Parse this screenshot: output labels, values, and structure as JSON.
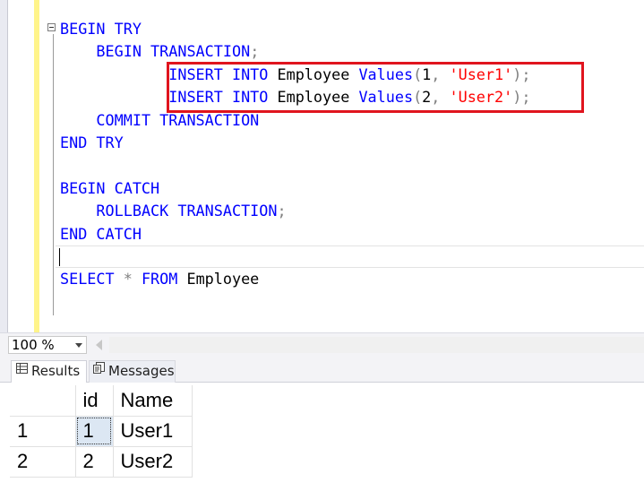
{
  "editor": {
    "lines": [
      [
        {
          "t": "BEGIN TRY",
          "c": "kw"
        }
      ],
      [
        {
          "t": "    "
        },
        {
          "t": "BEGIN TRANSACTION",
          "c": "kw"
        },
        {
          "t": ";",
          "c": "gr"
        }
      ],
      [
        {
          "t": "            "
        },
        {
          "t": "INSERT INTO",
          "c": "kw"
        },
        {
          "t": " Employee "
        },
        {
          "t": "Values",
          "c": "kw"
        },
        {
          "t": "(",
          "c": "gr"
        },
        {
          "t": "1"
        },
        {
          "t": ", ",
          "c": "gr"
        },
        {
          "t": "'User1'",
          "c": "str"
        },
        {
          "t": ");",
          "c": "gr"
        }
      ],
      [
        {
          "t": "            "
        },
        {
          "t": "INSERT INTO",
          "c": "kw"
        },
        {
          "t": " Employee "
        },
        {
          "t": "Values",
          "c": "kw"
        },
        {
          "t": "(",
          "c": "gr"
        },
        {
          "t": "2"
        },
        {
          "t": ", ",
          "c": "gr"
        },
        {
          "t": "'User2'",
          "c": "str"
        },
        {
          "t": ");",
          "c": "gr"
        }
      ],
      [
        {
          "t": "    "
        },
        {
          "t": "COMMIT TRANSACTION",
          "c": "kw"
        }
      ],
      [
        {
          "t": "END TRY",
          "c": "kw"
        }
      ],
      [
        {
          "t": ""
        }
      ],
      [
        {
          "t": "BEGIN CATCH",
          "c": "kw"
        }
      ],
      [
        {
          "t": "    "
        },
        {
          "t": "ROLLBACK TRANSACTION",
          "c": "kw"
        },
        {
          "t": ";",
          "c": "gr"
        }
      ],
      [
        {
          "t": "END CATCH",
          "c": "kw"
        }
      ],
      [
        {
          "t": ""
        }
      ],
      [
        {
          "t": "SELECT",
          "c": "kw"
        },
        {
          "t": " * ",
          "c": "gr"
        },
        {
          "t": "FROM",
          "c": "kw"
        },
        {
          "t": " Employee"
        }
      ]
    ]
  },
  "zoom": {
    "value": "100 %"
  },
  "tabs": {
    "results": "Results",
    "messages": "Messages"
  },
  "grid": {
    "columns": [
      "",
      "id",
      "Name"
    ],
    "rows": [
      [
        "1",
        "1",
        "User1"
      ],
      [
        "2",
        "2",
        "User2"
      ]
    ]
  },
  "colors": {
    "keyword": "#0000ff",
    "string": "#ff0000",
    "operator": "#808080",
    "highlight_box": "#e0141e"
  },
  "icons": {
    "fold": "collapse-box-icon",
    "results_tab": "grid-icon",
    "messages_tab": "messages-icon",
    "zoom": "dropdown-arrow-icon"
  }
}
